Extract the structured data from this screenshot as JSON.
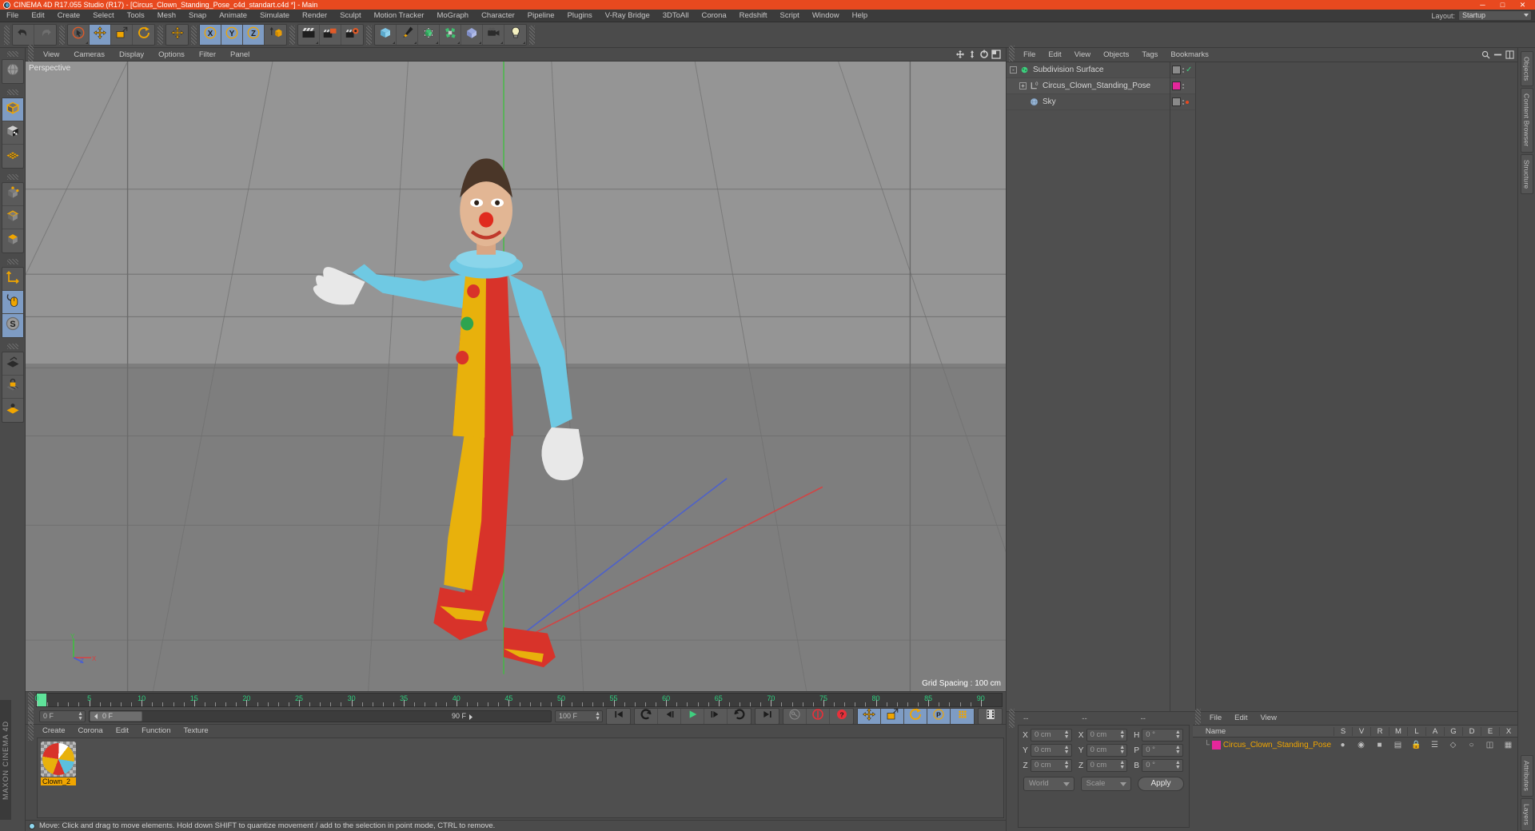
{
  "titlebar": {
    "title": "CINEMA 4D R17.055 Studio (R17) - [Circus_Clown_Standing_Pose_c4d_standart.c4d *] - Main",
    "minimize": "─",
    "maximize": "□",
    "close": "✕"
  },
  "menubar": {
    "items": [
      "File",
      "Edit",
      "Create",
      "Select",
      "Tools",
      "Mesh",
      "Snap",
      "Animate",
      "Simulate",
      "Render",
      "Sculpt",
      "Motion Tracker",
      "MoGraph",
      "Character",
      "Pipeline",
      "Plugins",
      "V-Ray Bridge",
      "3DToAll",
      "Corona",
      "Redshift",
      "Script",
      "Window",
      "Help"
    ],
    "layout_label": "Layout:",
    "layout_value": "Startup"
  },
  "toolbar": {
    "groups": [
      {
        "name": "undo-redo",
        "buttons": [
          {
            "name": "undo-button",
            "icon": "undo-icon",
            "selected": false,
            "corner": false
          },
          {
            "name": "redo-button",
            "icon": "redo-icon",
            "selected": false,
            "corner": false
          }
        ]
      },
      {
        "name": "transform-tools",
        "buttons": [
          {
            "name": "live-selection-tool",
            "icon": "cursor-select-icon",
            "selected": false,
            "corner": true
          },
          {
            "name": "move-tool",
            "icon": "move-icon",
            "selected": true,
            "corner": false
          },
          {
            "name": "scale-tool",
            "icon": "scale-icon",
            "selected": false,
            "corner": false
          },
          {
            "name": "rotate-tool",
            "icon": "rotate-icon",
            "selected": false,
            "corner": false
          }
        ]
      },
      {
        "name": "axis-lock",
        "buttons": [
          {
            "name": "world-axis-button",
            "icon": "move-icon",
            "selected": false,
            "corner": false
          }
        ]
      },
      {
        "name": "axis-xyz",
        "buttons": [
          {
            "name": "x-axis-toggle",
            "icon": "letter-x-icon",
            "selected": true,
            "corner": false
          },
          {
            "name": "y-axis-toggle",
            "icon": "letter-y-icon",
            "selected": true,
            "corner": false
          },
          {
            "name": "z-axis-toggle",
            "icon": "letter-z-icon",
            "selected": true,
            "corner": false
          },
          {
            "name": "world-object-coordinates-toggle",
            "icon": "world-cube-icon",
            "selected": false,
            "corner": false
          }
        ]
      },
      {
        "name": "render-tools",
        "buttons": [
          {
            "name": "render-view-button",
            "icon": "clapper-icon",
            "selected": false,
            "corner": true
          },
          {
            "name": "render-to-picture-viewer-button",
            "icon": "clapper-picture-icon",
            "selected": false,
            "corner": false
          },
          {
            "name": "render-settings-button",
            "icon": "clapper-gear-icon",
            "selected": false,
            "corner": false
          }
        ]
      },
      {
        "name": "object-creation",
        "buttons": [
          {
            "name": "add-primitive-button",
            "icon": "cube-icon",
            "selected": false,
            "corner": true
          },
          {
            "name": "add-spline-button",
            "icon": "pen-icon",
            "selected": false,
            "corner": true
          },
          {
            "name": "add-generator-button",
            "icon": "generator-icon",
            "selected": false,
            "corner": true
          },
          {
            "name": "add-deformer-button",
            "icon": "deformer-icon",
            "selected": false,
            "corner": true
          },
          {
            "name": "add-scene-object-button",
            "icon": "scene-icon",
            "selected": false,
            "corner": true
          },
          {
            "name": "add-camera-button",
            "icon": "camera-icon",
            "selected": false,
            "corner": true
          },
          {
            "name": "add-light-button",
            "icon": "light-bulb-icon",
            "selected": false,
            "corner": true
          }
        ]
      }
    ]
  },
  "leftbar": {
    "groups": [
      {
        "name": "mode-globe",
        "buttons": [
          {
            "name": "object-axis-mode-button",
            "icon": "globe-icon",
            "selected": false,
            "corner": false
          }
        ]
      },
      {
        "name": "editable-modes",
        "buttons": [
          {
            "name": "make-editable-button",
            "icon": "cube-grey-icon",
            "selected": true,
            "corner": true
          },
          {
            "name": "texture-mode-button",
            "icon": "checker-cube-icon",
            "selected": false,
            "corner": false
          },
          {
            "name": "viewport-solo-button",
            "icon": "grid-plane-icon",
            "selected": false,
            "corner": false
          }
        ]
      },
      {
        "name": "component-modes",
        "buttons": [
          {
            "name": "points-mode-button",
            "icon": "points-cube-icon",
            "selected": false,
            "corner": false
          },
          {
            "name": "edges-mode-button",
            "icon": "edges-cube-icon",
            "selected": false,
            "corner": false
          },
          {
            "name": "polygons-mode-button",
            "icon": "polygons-cube-icon",
            "selected": false,
            "corner": false
          }
        ]
      },
      {
        "name": "axis-and-snap",
        "buttons": [
          {
            "name": "enable-axis-modification-button",
            "icon": "axis-icon",
            "selected": false,
            "corner": false
          },
          {
            "name": "viewport-interaction-button",
            "icon": "mouse-icon",
            "selected": true,
            "corner": false
          },
          {
            "name": "soft-selection-button",
            "icon": "letter-s-circle-icon",
            "selected": true,
            "corner": true
          }
        ]
      },
      {
        "name": "workplane",
        "buttons": [
          {
            "name": "workplane-button",
            "icon": "workplane-icon",
            "selected": false,
            "corner": false
          },
          {
            "name": "lock-workplane-button",
            "icon": "lock-grid-icon",
            "selected": false,
            "corner": false
          },
          {
            "name": "workplane-mode-button",
            "icon": "workplane-mode-icon",
            "selected": false,
            "corner": false
          }
        ]
      }
    ]
  },
  "viewport": {
    "menu": [
      "View",
      "Cameras",
      "Display",
      "Options",
      "Filter",
      "Panel"
    ],
    "label": "Perspective",
    "grid_spacing": "Grid Spacing : 100 cm",
    "axis_labels": {
      "y": "Y",
      "x": "X",
      "z": "Z"
    }
  },
  "timeline": {
    "ticks": [
      0,
      5,
      10,
      15,
      20,
      25,
      30,
      35,
      40,
      45,
      50,
      55,
      60,
      65,
      70,
      75,
      80,
      85,
      90
    ],
    "current_frame": "0 F",
    "current_frame_field": "0 F",
    "scrub_value": "0 F",
    "end_frame_right": "90 F",
    "max_frame": "100 F",
    "transport": [
      {
        "name": "go-to-start-button",
        "icon": "skip-start-icon",
        "selected": false
      },
      {
        "name": "play-backwards-button",
        "icon": "play-back-icon",
        "selected": false
      },
      {
        "name": "previous-key-button",
        "icon": "prev-key-icon",
        "selected": false
      },
      {
        "name": "play-forwards-button",
        "icon": "play-icon",
        "selected": false
      },
      {
        "name": "next-key-button",
        "icon": "next-key-icon",
        "selected": false
      },
      {
        "name": "play-forward-loop-button",
        "icon": "loop-icon",
        "selected": false
      },
      {
        "name": "go-to-end-button",
        "icon": "skip-end-icon",
        "selected": false
      }
    ],
    "record_tools": [
      {
        "name": "autokeying-button",
        "icon": "key-icon",
        "selected": false
      },
      {
        "name": "record-active-objects-button",
        "icon": "record-circle-icon",
        "selected": false
      },
      {
        "name": "keyframe-selection-button",
        "icon": "question-circle-icon",
        "selected": false
      }
    ],
    "key_tools": [
      {
        "name": "record-position-button",
        "icon": "move-icon",
        "selected": true
      },
      {
        "name": "record-scale-button",
        "icon": "scale-icon",
        "selected": true
      },
      {
        "name": "record-rotation-button",
        "icon": "rotate-icon",
        "selected": true
      },
      {
        "name": "record-pla-button",
        "icon": "letter-p-circle-icon",
        "selected": true
      },
      {
        "name": "point-level-animation-button",
        "icon": "dots-grid-icon",
        "selected": true
      }
    ],
    "extra": [
      {
        "name": "timeline-button",
        "icon": "film-strip-icon",
        "selected": false
      }
    ]
  },
  "material_manager": {
    "menu": [
      "Create",
      "Corona",
      "Edit",
      "Function",
      "Texture"
    ],
    "materials": [
      {
        "name": "Clown_2",
        "label": "Clown_2",
        "selected": true
      }
    ]
  },
  "object_manager": {
    "menu": [
      "File",
      "Edit",
      "View",
      "Objects",
      "Tags",
      "Bookmarks"
    ],
    "header_icons": [
      "move-icon",
      "vertical-arrows-icon",
      "rotate-icon",
      "layout-icon"
    ],
    "rows": [
      {
        "name": "Subdivision Surface",
        "indent": 0,
        "expander": "-",
        "icon": "subdivision-surface-icon",
        "swatch": "#8a8a8a",
        "check": true
      },
      {
        "name": "Circus_Clown_Standing_Pose",
        "indent": 1,
        "expander": "+",
        "icon": "null-object-icon",
        "swatch": "#e5279b",
        "check": false
      },
      {
        "name": "Sky",
        "indent": 1,
        "expander": "",
        "icon": "sky-sphere-icon",
        "swatch": "#8a8a8a",
        "check": false,
        "dot": "#e8491f"
      }
    ]
  },
  "structure_manager": {
    "menu": [
      "File",
      "Edit",
      "View"
    ],
    "columns": [
      "S",
      "V",
      "R",
      "M",
      "L",
      "A",
      "G",
      "D",
      "E",
      "X"
    ],
    "name_column": "Name",
    "rows": [
      {
        "name": "Circus_Clown_Standing_Pose",
        "swatch": "#e5279b"
      }
    ]
  },
  "coordinates": {
    "headers": [
      "--",
      "--",
      "--"
    ],
    "rows": [
      {
        "label_pos": "X",
        "value_pos": "0 cm",
        "label_size": "X",
        "value_size": "0 cm",
        "label_rot": "H",
        "value_rot": "0 °"
      },
      {
        "label_pos": "Y",
        "value_pos": "0 cm",
        "label_size": "Y",
        "value_size": "0 cm",
        "label_rot": "P",
        "value_rot": "0 °"
      },
      {
        "label_pos": "Z",
        "value_pos": "0 cm",
        "label_size": "Z",
        "value_size": "0 cm",
        "label_rot": "B",
        "value_rot": "0 °"
      }
    ],
    "system": "World",
    "mode": "Scale",
    "apply": "Apply"
  },
  "statusbar": {
    "text": "Move: Click and drag to move elements. Hold down SHIFT to quantize movement / add to the selection in point mode, CTRL to remove."
  },
  "side_tabs": [
    "Objects",
    "Content Browser",
    "Structure"
  ],
  "right_tabs": [
    "Attributes",
    "Layers"
  ],
  "brand": "MAXON CINEMA 4D",
  "colors": {
    "accent": "#e8491f",
    "selection": "#7e9cc4",
    "panel": "#4b4b4b",
    "material_name_bg": "#f0a500",
    "object_pink": "#e5279b"
  }
}
